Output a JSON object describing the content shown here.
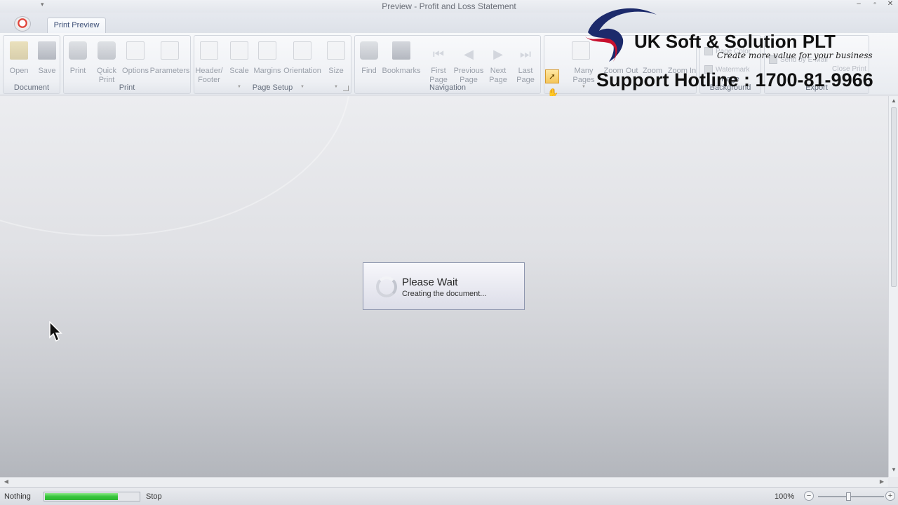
{
  "window": {
    "title": "Preview - Profit and Loss Statement",
    "minimize": "–",
    "maximize": "▫",
    "close": "✕"
  },
  "tabs": [
    {
      "label": "Print Preview",
      "active": true
    }
  ],
  "ribbon": {
    "groups": {
      "document": {
        "label": "Document",
        "buttons": [
          {
            "label": "Open",
            "icon": "folder-open-icon"
          },
          {
            "label": "Save",
            "icon": "save-icon"
          }
        ]
      },
      "print": {
        "label": "Print",
        "buttons": [
          {
            "label": "Print",
            "icon": "printer-icon"
          },
          {
            "label": "Quick Print",
            "icon": "quick-print-icon"
          },
          {
            "label": "Options",
            "icon": "options-icon"
          },
          {
            "label": "Parameters",
            "icon": "parameters-icon"
          }
        ]
      },
      "page_setup": {
        "label": "Page Setup",
        "buttons": [
          {
            "label": "Header/ Footer",
            "icon": "header-footer-icon"
          },
          {
            "label": "Scale",
            "icon": "scale-icon"
          },
          {
            "label": "Margins",
            "icon": "margins-icon"
          },
          {
            "label": "Orientation",
            "icon": "orientation-icon"
          },
          {
            "label": "Size",
            "icon": "page-size-icon"
          }
        ]
      },
      "navigation": {
        "label": "Navigation",
        "buttons": [
          {
            "label": "Find",
            "icon": "binoculars-icon"
          },
          {
            "label": "Bookmarks",
            "icon": "bookmarks-icon"
          },
          {
            "label": "First Page",
            "icon": "first-page-icon"
          },
          {
            "label": "Previous Page",
            "icon": "previous-page-icon"
          },
          {
            "label": "Next Page",
            "icon": "next-page-icon"
          },
          {
            "label": "Last Page",
            "icon": "last-page-icon"
          }
        ]
      },
      "zoom": {
        "buttons": [
          {
            "label": "Many Pages",
            "icon": "many-pages-icon"
          },
          {
            "label": "Zoom Out",
            "icon": "zoom-out-icon"
          },
          {
            "label": "Zoom",
            "icon": "zoom-icon"
          },
          {
            "label": "Zoom In",
            "icon": "zoom-in-icon"
          }
        ]
      },
      "page_background": {
        "label": "Page Background",
        "items": [
          "Page Color",
          "Watermark"
        ]
      },
      "export": {
        "label": "Export",
        "items": [
          "Send by E-Mail"
        ],
        "close_label": "Close Print"
      }
    }
  },
  "branding": {
    "company": "UK Soft & Solution PLT",
    "slogan": "Create more value for your business",
    "hotline": "Support Hotline : 1700-81-9966"
  },
  "dialog": {
    "title": "Please Wait",
    "message": "Creating the document..."
  },
  "statusbar": {
    "status": "Nothing",
    "progress_percent": 78,
    "stop_label": "Stop",
    "zoom": "100%"
  },
  "colors": {
    "progress_fill": "#36c43b",
    "active_tool": "#f4c55a",
    "swoosh_blue": "#1c2a6b",
    "swoosh_red": "#c8102e"
  }
}
